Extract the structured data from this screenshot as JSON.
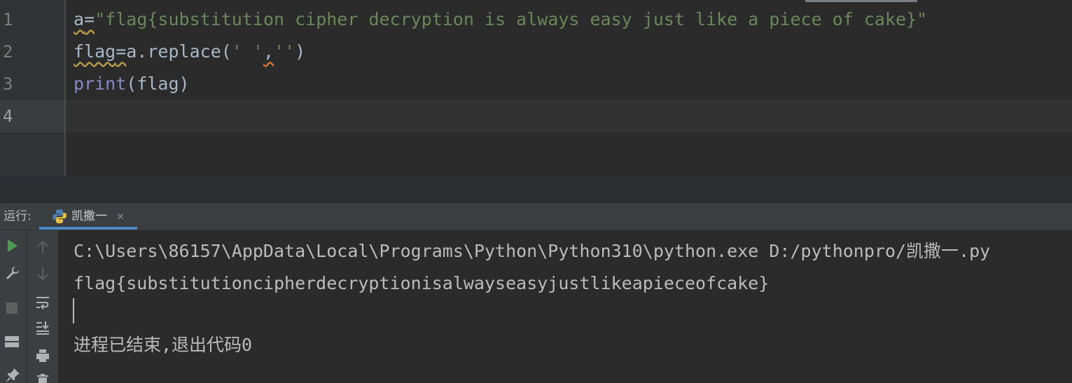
{
  "editor": {
    "line_numbers": [
      "1",
      "2",
      "3",
      "4"
    ],
    "line1": {
      "var": "a",
      "op": "=",
      "str": "\"flag{substitution cipher decryption is always easy just like a piece of cake}\""
    },
    "line2": {
      "var": "flag",
      "op": "=",
      "call": "a.replace(",
      "arg1": "' '",
      "comma": ",",
      "arg2": "''",
      "close": ")"
    },
    "line3": {
      "kw": "print",
      "rest": "(flag)"
    }
  },
  "run_panel": {
    "label": "运行:",
    "tab_name": "凯撒一",
    "close_glyph": "✕"
  },
  "console": {
    "command": "C:\\Users\\86157\\AppData\\Local\\Programs\\Python\\Python310\\python.exe D:/pythonpro/凯撒一.py",
    "output": "flag{substitutioncipherdecryptionisalwayseasyjustlikeapieceofcake}",
    "exit_message": "进程已结束,退出代码0"
  },
  "icons": {
    "run": "play-icon",
    "wrench": "wrench-icon",
    "stop": "stop-icon",
    "layout": "layout-icon",
    "pin": "pin-icon",
    "up": "arrow-up-icon",
    "down": "arrow-down-icon",
    "wrap": "soft-wrap-icon",
    "scroll_end": "scroll-to-end-icon",
    "print": "print-icon",
    "trash": "trash-icon"
  },
  "colors": {
    "string": "#6a8759",
    "keyword": "#8888c6",
    "run_green": "#499c54",
    "tab_accent": "#4a88c7"
  }
}
